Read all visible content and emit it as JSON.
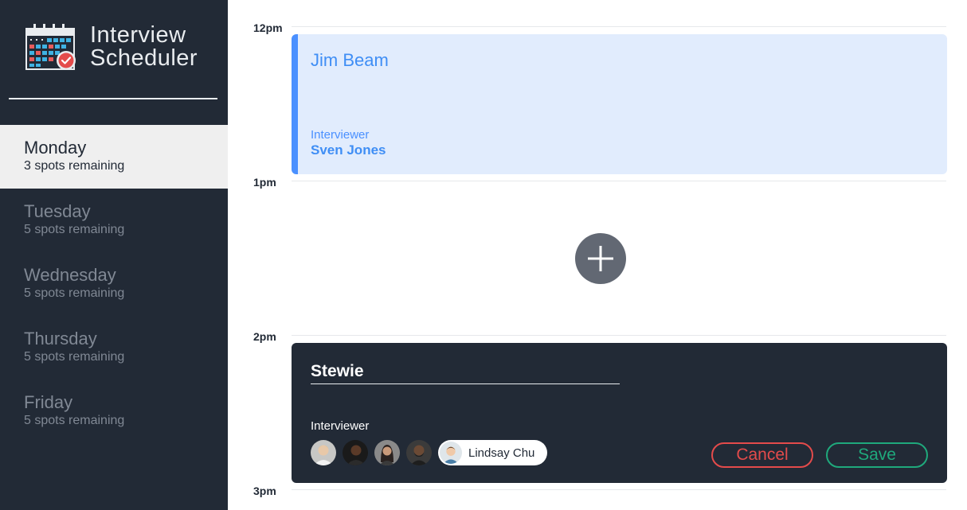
{
  "brand": {
    "line1": "Interview",
    "line2": "Scheduler",
    "logo_icon": "calendar-check-icon"
  },
  "days": [
    {
      "name": "Monday",
      "spots": "3 spots remaining",
      "selected": true
    },
    {
      "name": "Tuesday",
      "spots": "5 spots remaining",
      "selected": false
    },
    {
      "name": "Wednesday",
      "spots": "5 spots remaining",
      "selected": false
    },
    {
      "name": "Thursday",
      "spots": "5 spots remaining",
      "selected": false
    },
    {
      "name": "Friday",
      "spots": "5 spots remaining",
      "selected": false
    }
  ],
  "times": [
    "12pm",
    "1pm",
    "2pm",
    "3pm"
  ],
  "appointment": {
    "student": "Jim Beam",
    "interviewer_label": "Interviewer",
    "interviewer": "Sven Jones"
  },
  "add_button": {
    "icon": "plus-icon"
  },
  "form": {
    "student_value": "Stewie",
    "interviewer_label": "Interviewer",
    "selected_interviewer": "Lindsay Chu",
    "cancel_label": "Cancel",
    "save_label": "Save"
  },
  "colors": {
    "sidebar": "#222a36",
    "appointment_bg": "#e1ecfd",
    "appointment_accent": "#4a90ff",
    "cancel": "#e44b4b",
    "save": "#1fa97c"
  }
}
